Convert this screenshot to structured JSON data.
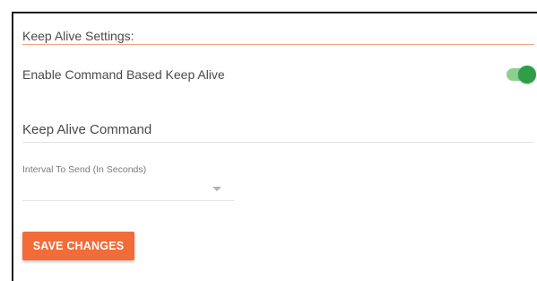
{
  "settings": {
    "section_title": "Keep Alive Settings:",
    "enable_toggle": {
      "label": "Enable Command Based Keep Alive",
      "state": "on",
      "track_color": "#8cd08f",
      "knob_color": "#2e9e48"
    },
    "command_field": {
      "label": "Keep Alive Command",
      "value": ""
    },
    "interval_select": {
      "label": "Interval To Send (In Seconds)",
      "value": ""
    },
    "save_button": {
      "label": "SAVE CHANGES",
      "color": "#f26c3a"
    },
    "divider_color": "#f0a37f"
  }
}
